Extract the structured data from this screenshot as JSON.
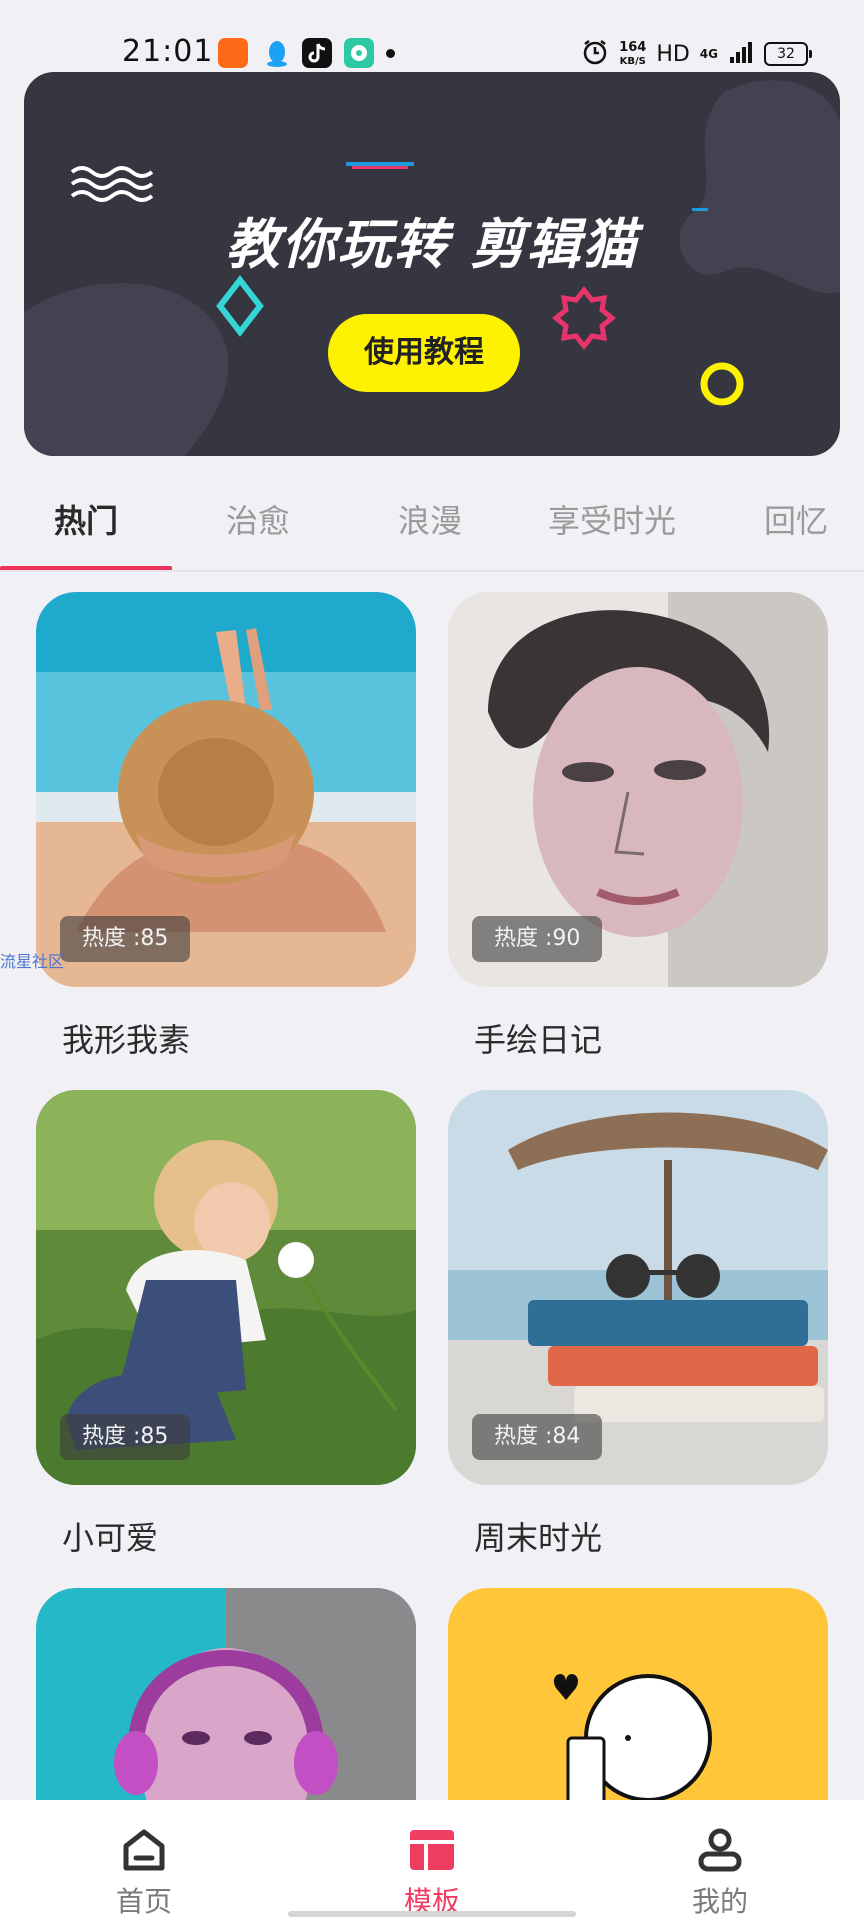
{
  "status_bar": {
    "time": "21:01",
    "net_speed_value": "164",
    "net_speed_unit": "KB/S",
    "hd": "HD",
    "network": "4G",
    "battery": "32",
    "icons": [
      "kuaishou-icon",
      "qq-icon",
      "tiktok-icon",
      "chat-app-icon",
      "alarm-icon",
      "signal-icon"
    ]
  },
  "banner": {
    "title": "教你玩转  剪辑猫",
    "button_label": "使用教程",
    "colors": {
      "background": "#363640",
      "button": "#fff200"
    }
  },
  "tabs": [
    {
      "label": "热门",
      "active": true
    },
    {
      "label": "治愈",
      "active": false
    },
    {
      "label": "浪漫",
      "active": false
    },
    {
      "label": "享受时光",
      "active": false
    },
    {
      "label": "回忆",
      "active": false
    }
  ],
  "side_tag": "流星社区",
  "templates": [
    {
      "name": "我形我素",
      "heat": "热度 :85"
    },
    {
      "name": "手绘日记",
      "heat": "热度 :90"
    },
    {
      "name": "小可爱",
      "heat": "热度 :85"
    },
    {
      "name": "周末时光",
      "heat": "热度 :84"
    }
  ],
  "bottom_nav": [
    {
      "label": "首页",
      "icon": "home-icon",
      "active": false
    },
    {
      "label": "模板",
      "icon": "template-icon",
      "active": true
    },
    {
      "label": "我的",
      "icon": "user-icon",
      "active": false
    }
  ],
  "accent_color": "#f0315b"
}
